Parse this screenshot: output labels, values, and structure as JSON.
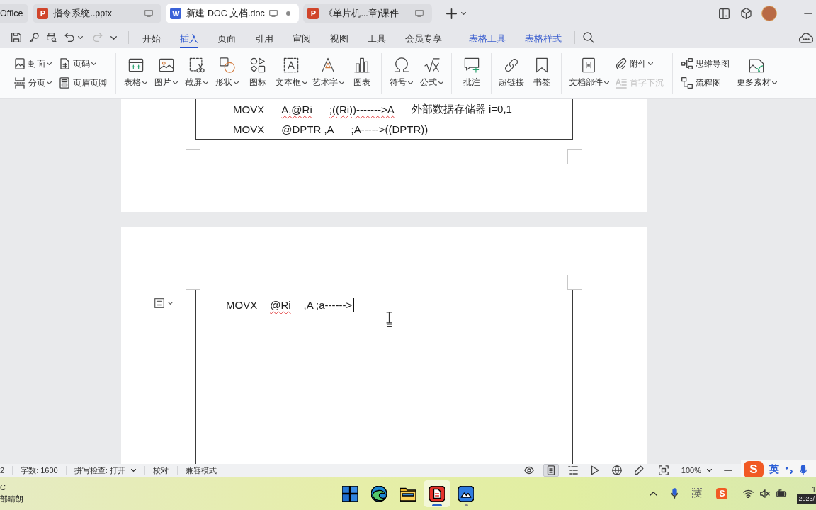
{
  "tabs": [
    {
      "label": "Office",
      "kind": "home",
      "selected": false,
      "modified": false
    },
    {
      "label": "指令系统..pptx",
      "kind": "presentation",
      "badge": "P",
      "selected": false,
      "modified": false
    },
    {
      "label": "新建 DOC 文档.doc",
      "kind": "document",
      "badge": "W",
      "selected": true,
      "modified": true
    },
    {
      "label": "《单片机...章)课件",
      "kind": "presentation",
      "badge": "P",
      "selected": false,
      "modified": false
    }
  ],
  "quick_access": [
    {
      "disabled": false
    },
    {
      "disabled": false
    },
    {
      "disabled": false
    },
    {
      "disabled": false
    },
    {
      "disabled": true
    }
  ],
  "menu": [
    {
      "label": "开始",
      "kind": "main",
      "selected": false
    },
    {
      "label": "插入",
      "kind": "main",
      "selected": true
    },
    {
      "label": "页面",
      "kind": "main",
      "selected": false
    },
    {
      "label": "引用",
      "kind": "main",
      "selected": false
    },
    {
      "label": "审阅",
      "kind": "main",
      "selected": false
    },
    {
      "label": "视图",
      "kind": "main",
      "selected": false
    },
    {
      "label": "工具",
      "kind": "main",
      "selected": false
    },
    {
      "label": "会员专享",
      "kind": "main",
      "selected": false
    },
    {
      "label": "表格工具",
      "kind": "context",
      "selected": false
    },
    {
      "label": "表格样式",
      "kind": "context",
      "selected": false
    }
  ],
  "ribbon": [
    {
      "items": [
        {
          "label": "封面",
          "kind": "small",
          "dropdown": true,
          "disabled": false
        },
        {
          "label": "分页",
          "kind": "small",
          "dropdown": true,
          "disabled": false
        },
        {
          "label": "页码",
          "kind": "small",
          "dropdown": true,
          "disabled": false
        },
        {
          "label": "页眉页脚",
          "kind": "small",
          "dropdown": false,
          "disabled": false
        }
      ]
    },
    {
      "items": [
        {
          "label": "表格",
          "kind": "large",
          "dropdown": true,
          "disabled": false
        },
        {
          "label": "图片",
          "kind": "large",
          "dropdown": true,
          "disabled": false
        },
        {
          "label": "截屏",
          "kind": "large",
          "dropdown": true,
          "disabled": false
        },
        {
          "label": "形状",
          "kind": "large",
          "dropdown": true,
          "disabled": false
        },
        {
          "label": "图标",
          "kind": "large",
          "dropdown": false,
          "disabled": false
        },
        {
          "label": "文本框",
          "kind": "large",
          "dropdown": true,
          "disabled": false
        },
        {
          "label": "艺术字",
          "kind": "large",
          "dropdown": true,
          "disabled": false
        },
        {
          "label": "图表",
          "kind": "large",
          "dropdown": false,
          "disabled": false
        }
      ]
    },
    {
      "items": [
        {
          "label": "符号",
          "kind": "large",
          "dropdown": true,
          "disabled": false
        },
        {
          "label": "公式",
          "kind": "large",
          "dropdown": true,
          "disabled": false
        }
      ]
    },
    {
      "items": [
        {
          "label": "批注",
          "kind": "large",
          "dropdown": false,
          "disabled": false
        }
      ]
    },
    {
      "items": [
        {
          "label": "超链接",
          "kind": "large",
          "dropdown": false,
          "disabled": false
        },
        {
          "label": "书签",
          "kind": "large",
          "dropdown": false,
          "disabled": false
        }
      ]
    },
    {
      "items": [
        {
          "label": "文档部件",
          "kind": "large",
          "dropdown": true,
          "disabled": false
        },
        {
          "label": "附件",
          "kind": "small",
          "dropdown": true,
          "disabled": false
        },
        {
          "label": "首字下沉",
          "kind": "small",
          "dropdown": false,
          "disabled": true
        }
      ]
    },
    {
      "items": [
        {
          "label": "思维导图",
          "kind": "small",
          "dropdown": false,
          "disabled": false
        },
        {
          "label": "流程图",
          "kind": "small",
          "dropdown": false,
          "disabled": false
        },
        {
          "label": "更多素材",
          "kind": "large",
          "dropdown": true,
          "disabled": false
        }
      ]
    }
  ],
  "document": {
    "pages": [
      {
        "rows": [
          {
            "tokens": [
              {
                "text": "MOVX",
                "misspelled": false
              },
              {
                "text": "A,@Ri",
                "misspelled": true
              },
              {
                "text": ";((Ri))------->A",
                "misspelled": true
              },
              {
                "text": "外部数据存储器 i=0,1",
                "misspelled": false
              }
            ]
          },
          {
            "tokens": [
              {
                "text": "MOVX",
                "misspelled": false
              },
              {
                "text": "@DPTR ,A",
                "misspelled": false
              },
              {
                "text": ";A----->((DPTR))",
                "misspelled": false
              }
            ]
          }
        ]
      },
      {
        "rows": [
          {
            "tokens": [
              {
                "text": "MOVX",
                "misspelled": false
              },
              {
                "text": "@Ri",
                "misspelled": true
              },
              {
                "text": ",A ;a------>",
                "misspelled": false
              }
            ]
          }
        ]
      }
    ]
  },
  "status_bar": {
    "page": "2",
    "word_count": "字数: 1600",
    "spell_check": "拼写检查: 打开",
    "proofread": "校对",
    "mode": "兼容模式",
    "views": [
      {
        "selected": false
      },
      {
        "selected": true
      },
      {
        "selected": false
      },
      {
        "selected": false
      },
      {
        "selected": false
      },
      {
        "selected": false
      }
    ],
    "zoom": "100%"
  },
  "input_method": {
    "logo": "S",
    "mode": "英"
  },
  "taskbar": {
    "weather": {
      "temperature": "C",
      "condition": "部晴朗"
    },
    "apps": [
      {
        "active": false,
        "running": false
      },
      {
        "active": false,
        "running": false
      },
      {
        "active": false,
        "running": false
      },
      {
        "active": true,
        "running": true
      },
      {
        "active": false,
        "running": true
      }
    ],
    "tray": {
      "ime_mode": "英",
      "ime_logo": "S"
    },
    "clock": {
      "time": "1",
      "date": "2023/"
    }
  }
}
